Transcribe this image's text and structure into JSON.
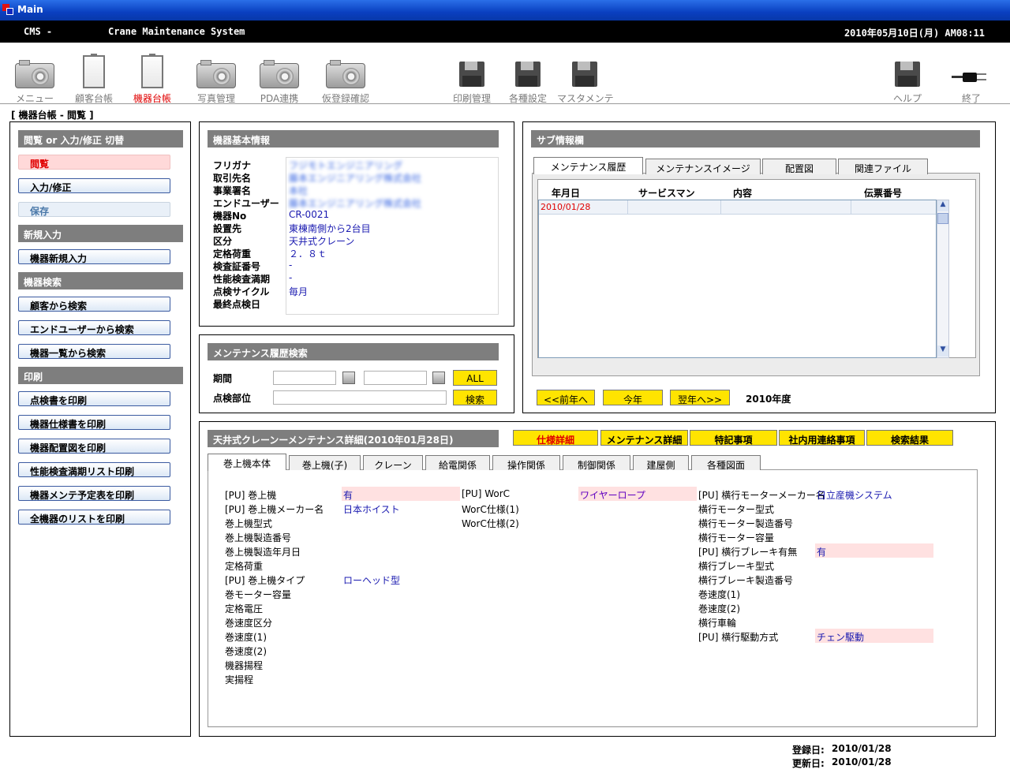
{
  "window": {
    "title": "Main"
  },
  "header": {
    "app_code": "CMS -",
    "app_name": "Crane Maintenance System",
    "datetime": "2010年05月10日(月) AM08:11"
  },
  "toolbar": [
    {
      "label": "メニュー",
      "icon": "camera-icon"
    },
    {
      "label": "顧客台帳",
      "icon": "card-icon"
    },
    {
      "label": "機器台帳",
      "icon": "card-icon",
      "active": true
    },
    {
      "label": "写真管理",
      "icon": "camera-icon"
    },
    {
      "label": "PDA連携",
      "icon": "camera-icon"
    },
    {
      "label": "仮登録確認",
      "icon": "camera-icon"
    },
    {
      "label": "印刷管理",
      "icon": "disk-icon"
    },
    {
      "label": "各種設定",
      "icon": "disk-icon"
    },
    {
      "label": "マスタメンテ",
      "icon": "disk-icon"
    },
    {
      "label": "ヘルプ",
      "icon": "disk-icon"
    },
    {
      "label": "終了",
      "icon": "plug-icon"
    }
  ],
  "breadcrumb": "[ 機器台帳 - 閲覧 ]",
  "sidebar": {
    "mode_header": "閲覧 or 入力/修正 切替",
    "view_button": "閲覧",
    "edit_button": "入力/修正",
    "save_button": "保存",
    "new_header": "新規入力",
    "new_button": "機器新規入力",
    "search_header": "機器検索",
    "search_buttons": [
      "顧客から検索",
      "エンドユーザーから検索",
      "機器一覧から検索"
    ],
    "print_header": "印刷",
    "print_buttons": [
      "点検書を印刷",
      "機器仕様書を印刷",
      "機器配置図を印刷",
      "性能検査満期リスト印刷",
      "機器メンテ予定表を印刷",
      "全機器のリストを印刷"
    ]
  },
  "basic_info": {
    "title": "機器基本情報",
    "fields": [
      {
        "label": "フリガナ",
        "value": "フジモトエンジニアリング",
        "blurred": true
      },
      {
        "label": "取引先名",
        "value": "藤本エンジニアリング株式会社",
        "blurred": true
      },
      {
        "label": "事業署名",
        "value": "本社",
        "blurred": true
      },
      {
        "label": "エンドユーザー",
        "value": "藤本エンジニアリング株式会社",
        "blurred": true
      },
      {
        "label": "機器No",
        "value": "CR-0021"
      },
      {
        "label": "設置先",
        "value": "東棟南側から2台目"
      },
      {
        "label": "区分",
        "value": "天井式クレーン"
      },
      {
        "label": "定格荷重",
        "value": "２．８ｔ"
      },
      {
        "label": "検査証番号",
        "value": "-"
      },
      {
        "label": "性能検査満期",
        "value": "-"
      },
      {
        "label": "点検サイクル",
        "value": "毎月"
      },
      {
        "label": "最終点検日",
        "value": ""
      }
    ]
  },
  "maint_search": {
    "title": "メンテナンス履歴検索",
    "period_label": "期間",
    "part_label": "点検部位",
    "all_button": "ALL",
    "search_button": "検索"
  },
  "sub_info": {
    "title": "サブ情報欄",
    "tabs": [
      "メンテナンス履歴",
      "メンテナンスイメージ",
      "配置図",
      "関連ファイル"
    ],
    "columns": [
      "年月日",
      "サービスマン",
      "内容",
      "伝票番号"
    ],
    "rows": [
      {
        "date": "2010/01/28",
        "serviceman": "",
        "content": "",
        "slip": ""
      }
    ],
    "prev_button": "<<前年へ",
    "this_button": "今年",
    "next_button": "翌年へ>>",
    "year_label": "2010年度"
  },
  "detail": {
    "title": "天井式クレーンーメンテナンス詳細(2010年01月28日)",
    "buttons": [
      "仕様詳細",
      "メンテナンス詳細",
      "特記事項",
      "社内用連絡事項",
      "検索結果"
    ],
    "tabs": [
      "巻上機本体",
      "巻上機(子)",
      "クレーン",
      "給電関係",
      "操作関係",
      "制御関係",
      "建屋側",
      "各種図面"
    ],
    "col1": [
      {
        "label": "[PU] 巻上機",
        "value": "有",
        "pink": true
      },
      {
        "label": "[PU] 巻上機メーカー名",
        "value": "日本ホイスト"
      },
      {
        "label": "巻上機型式",
        "value": ""
      },
      {
        "label": "巻上機製造番号",
        "value": ""
      },
      {
        "label": "巻上機製造年月日",
        "value": ""
      },
      {
        "label": "定格荷重",
        "value": ""
      },
      {
        "label": "[PU] 巻上機タイプ",
        "value": "ローヘッド型"
      },
      {
        "label": "巻モーター容量",
        "value": ""
      },
      {
        "label": "定格電圧",
        "value": ""
      },
      {
        "label": "巻速度区分",
        "value": ""
      },
      {
        "label": "巻速度(1)",
        "value": ""
      },
      {
        "label": "巻速度(2)",
        "value": ""
      },
      {
        "label": "機器揚程",
        "value": ""
      },
      {
        "label": "実揚程",
        "value": ""
      }
    ],
    "col2": [
      {
        "label": "[PU] WorC",
        "value": "ワイヤーロープ",
        "pink": true
      },
      {
        "label": "WorC仕様(1)",
        "value": ""
      },
      {
        "label": "WorC仕様(2)",
        "value": ""
      }
    ],
    "col3": [
      {
        "label": "[PU] 横行モーターメーカー名",
        "value": "日立産機システム"
      },
      {
        "label": "横行モーター型式",
        "value": ""
      },
      {
        "label": "横行モーター製造番号",
        "value": ""
      },
      {
        "label": "横行モーター容量",
        "value": ""
      },
      {
        "label": "[PU] 横行ブレーキ有無",
        "value": "有",
        "pink": true
      },
      {
        "label": "横行ブレーキ型式",
        "value": ""
      },
      {
        "label": "横行ブレーキ製造番号",
        "value": ""
      },
      {
        "label": "巻速度(1)",
        "value": ""
      },
      {
        "label": "巻速度(2)",
        "value": ""
      },
      {
        "label": "横行車輪",
        "value": ""
      },
      {
        "label": "[PU] 横行駆動方式",
        "value": "チェン駆動",
        "pink": true
      }
    ]
  },
  "footer": {
    "registered_label": "登録日:",
    "registered_date": "2010/01/28",
    "updated_label": "更新日:",
    "updated_date": "2010/01/28"
  }
}
